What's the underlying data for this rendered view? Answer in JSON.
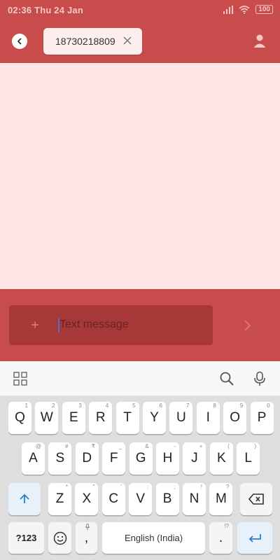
{
  "status_bar": {
    "time_date": "02:36 Thu 24 Jan",
    "battery": "100"
  },
  "header": {
    "recipient": "18730218809"
  },
  "compose": {
    "placeholder": "Text message"
  },
  "keyboard": {
    "row1": [
      {
        "label": "Q",
        "hint": "1"
      },
      {
        "label": "W",
        "hint": "2"
      },
      {
        "label": "E",
        "hint": "3"
      },
      {
        "label": "R",
        "hint": "4"
      },
      {
        "label": "T",
        "hint": "5"
      },
      {
        "label": "Y",
        "hint": "6"
      },
      {
        "label": "U",
        "hint": "7"
      },
      {
        "label": "I",
        "hint": "8"
      },
      {
        "label": "O",
        "hint": "9"
      },
      {
        "label": "P",
        "hint": "0"
      }
    ],
    "row2": [
      {
        "label": "A",
        "hint": "@"
      },
      {
        "label": "S",
        "hint": "#"
      },
      {
        "label": "D",
        "hint": "₹"
      },
      {
        "label": "F",
        "hint": "_"
      },
      {
        "label": "G",
        "hint": "&"
      },
      {
        "label": "H",
        "hint": "-"
      },
      {
        "label": "J",
        "hint": "+"
      },
      {
        "label": "K",
        "hint": "("
      },
      {
        "label": "L",
        "hint": ")"
      }
    ],
    "row3": [
      {
        "label": "Z",
        "hint": "*"
      },
      {
        "label": "X",
        "hint": "\""
      },
      {
        "label": "C",
        "hint": "'"
      },
      {
        "label": "V",
        "hint": ":"
      },
      {
        "label": "B",
        "hint": ";"
      },
      {
        "label": "N",
        "hint": "!"
      },
      {
        "label": "M",
        "hint": "?"
      }
    ],
    "symbols_key": "?123",
    "comma_key": ",",
    "space_key": "English (India)",
    "period_key": ".",
    "period_hint": "!?"
  }
}
